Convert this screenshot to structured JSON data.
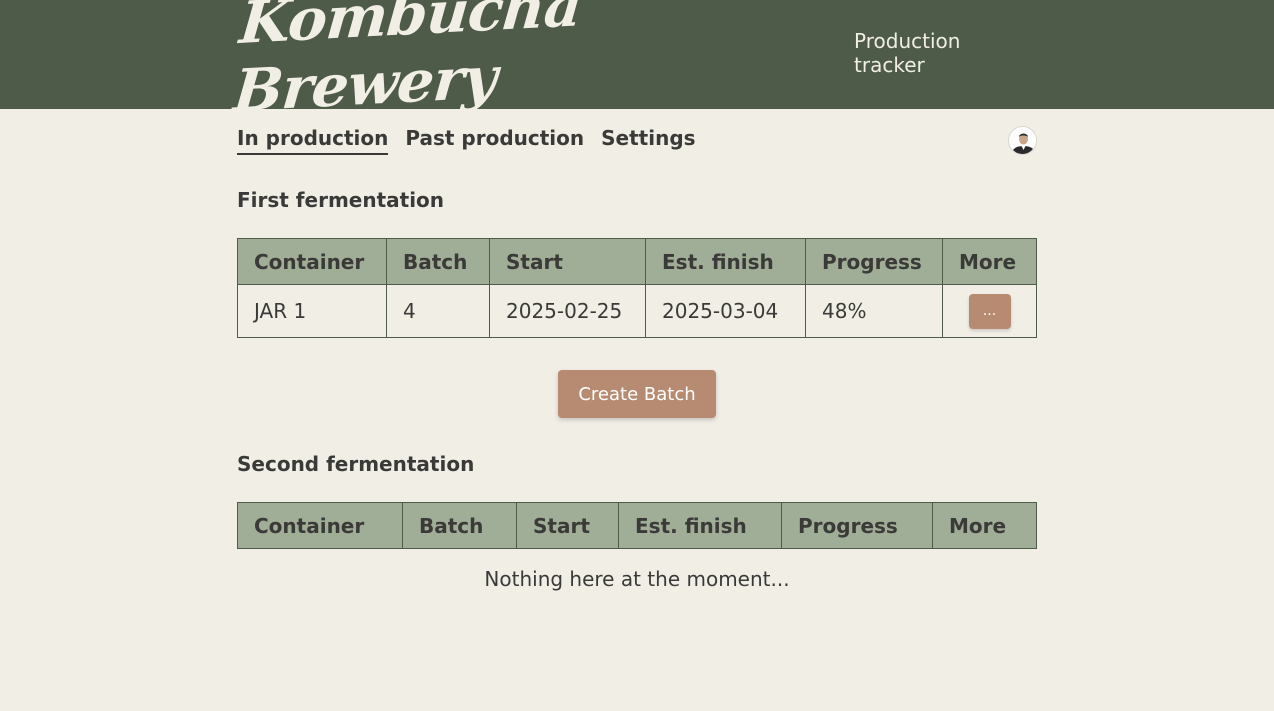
{
  "header": {
    "brand": "Kombucha Brewery",
    "subtitle": "Production tracker"
  },
  "nav": {
    "tabs": [
      {
        "label": "In production",
        "active": true
      },
      {
        "label": "Past production",
        "active": false
      },
      {
        "label": "Settings",
        "active": false
      }
    ],
    "avatar_icon": "user-avatar-icon"
  },
  "first": {
    "title": "First fermentation",
    "columns": [
      "Container",
      "Batch",
      "Start",
      "Est. finish",
      "Progress",
      "More"
    ],
    "rows": [
      {
        "container": "JAR 1",
        "batch": "4",
        "start": "2025-02-25",
        "finish": "2025-03-04",
        "progress": "48%",
        "more": "..."
      }
    ]
  },
  "create_batch_label": "Create Batch",
  "second": {
    "title": "Second fermentation",
    "columns": [
      "Container",
      "Batch",
      "Start",
      "Est. finish",
      "Progress",
      "More"
    ],
    "empty_message": "Nothing here at the moment..."
  },
  "colors": {
    "header_bg": "#4d5b48",
    "page_bg": "#f1eee6",
    "table_header_bg": "#a0ad97",
    "button_bg": "#b68b72"
  }
}
